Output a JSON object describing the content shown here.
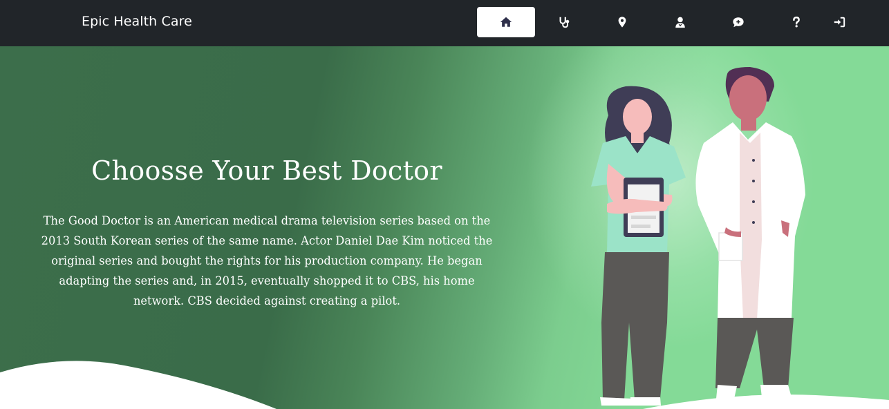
{
  "navbar": {
    "brand": "Epic Health Care",
    "items": [
      {
        "icon": "home-icon",
        "active": true
      },
      {
        "icon": "stethoscope-icon",
        "active": false
      },
      {
        "icon": "map-marker-icon",
        "active": false
      },
      {
        "icon": "user-doctor-icon",
        "active": false
      },
      {
        "icon": "comment-plus-icon",
        "active": false
      },
      {
        "icon": "question-icon",
        "active": false
      },
      {
        "icon": "sign-in-icon",
        "active": false
      }
    ]
  },
  "hero": {
    "title": "Choosse Your Best Doctor",
    "description": "The Good Doctor is an American medical drama television series based on the 2013 South Korean series of the same name. Actor Daniel Dae Kim noticed the original series and bought the rights for his production company. He began adapting the series and, in 2015, eventually shopped it to CBS, his home network. CBS decided against creating a pilot."
  },
  "colors": {
    "navbar_bg": "#212529",
    "hero_dark_green": "#3a6c49",
    "hero_light_green": "#84da97",
    "active_nav_bg": "#ffffff"
  }
}
